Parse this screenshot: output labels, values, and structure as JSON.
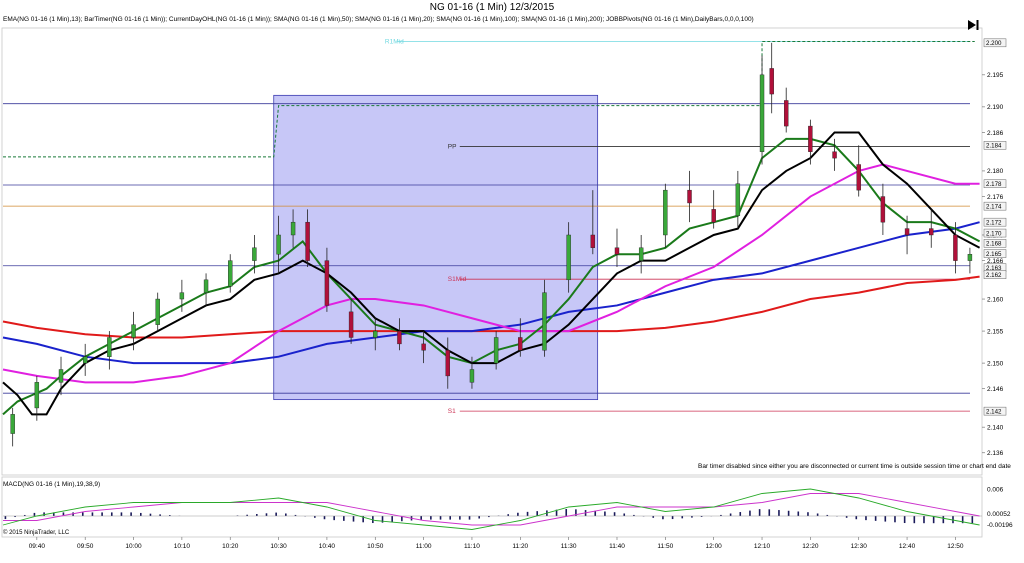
{
  "title": "NG 01-16 (1 Min)  12/3/2015",
  "indicators_line": "EMA(NG 01-16 (1 Min),13); BarTimer(NG 01-16 (1 Min)); CurrentDayOHL(NG 01-16 (1 Min)); SMA(NG 01-16 (1 Min),50); SMA(NG 01-16 (1 Min),20); SMA(NG 01-16 (1 Min),100); SMA(NG 01-16 (1 Min),200); JOBBPivots(NG 01-16 (1 Min),DailyBars,0,0,0,100)",
  "bar_timer_note": "Bar timer disabled since either you are disconnected or current time is outside session time or chart end date",
  "macd_label": "MACD(NG 01-16 (1 Min),19,38,9)",
  "copyright": "© 2015 NinjaTrader, LLC",
  "icons": {
    "play_to_end": "skip-to-end-icon"
  },
  "colors": {
    "up_bar": "#3aa83a",
    "down_bar": "#b0103a",
    "ema13": "#1a7a1a",
    "sma20": "#000000",
    "sma50": "#e020e0",
    "sma100": "#1a22cc",
    "sma200": "#e01a1a",
    "zone": "#b4b4f4",
    "macd": "#2aaa2a",
    "signal": "#cc33cc",
    "hist": "#1a1a5a"
  },
  "chart_data": {
    "type": "candlestick",
    "symbol": "NG 01-16",
    "interval": "1 Min",
    "date": "12/3/2015",
    "x_tick_labels": [
      "09:40",
      "09:50",
      "10:00",
      "10:10",
      "10:20",
      "10:30",
      "10:40",
      "10:50",
      "11:00",
      "11:10",
      "11:20",
      "11:30",
      "11:40",
      "11:50",
      "12:00",
      "12:10",
      "12:20",
      "12:30",
      "12:40",
      "12:50"
    ],
    "y_tick_labels": [
      "2.136",
      "2.140",
      "2.146",
      "2.150",
      "2.155",
      "2.160",
      "2.166",
      "2.170",
      "2.176",
      "2.180",
      "2.186",
      "2.190",
      "2.195"
    ],
    "ylim": [
      2.133,
      2.202
    ],
    "price_labels": [
      {
        "text": "2.200",
        "value": 2.2
      },
      {
        "text": "2.184",
        "value": 2.184
      },
      {
        "text": "2.178",
        "value": 2.178
      },
      {
        "text": "2.174",
        "value": 2.1745
      },
      {
        "text": "2.172",
        "value": 2.172
      },
      {
        "text": "2.170",
        "value": 2.1703
      },
      {
        "text": "2.168",
        "value": 2.1687
      },
      {
        "text": "2.165",
        "value": 2.1671
      },
      {
        "text": "2.163",
        "value": 2.1649
      },
      {
        "text": "2.162",
        "value": 2.1638
      },
      {
        "text": "2.142",
        "value": 2.1425
      }
    ],
    "pivot_levels": [
      {
        "label": "R1Mid",
        "value": 2.2002,
        "color": "#70d8e0"
      },
      {
        "label": "",
        "value": 2.1905,
        "color": "#3a3a9a"
      },
      {
        "label": "PP",
        "value": 2.1838,
        "color": "#333333"
      },
      {
        "label": "",
        "value": 2.1778,
        "color": "#3a3a9a"
      },
      {
        "label": "",
        "value": 2.1745,
        "color": "#d08a30"
      },
      {
        "label": "",
        "value": 2.1652,
        "color": "#3a3a9a"
      },
      {
        "label": "S1Mid",
        "value": 2.1631,
        "color": "#cc3355"
      },
      {
        "label": "",
        "value": 2.1453,
        "color": "#3a3a9a"
      },
      {
        "label": "S1",
        "value": 2.1425,
        "color": "#cc3355"
      }
    ],
    "day_high_step": [
      {
        "time": "09:33",
        "value": 2.1822
      },
      {
        "time": "10:29",
        "value": 2.1822
      },
      {
        "time": "10:30",
        "value": 2.1902
      },
      {
        "time": "12:10",
        "value": 2.1902
      },
      {
        "time": "12:10",
        "value": 2.2002
      },
      {
        "time": "12:54",
        "value": 2.2002
      }
    ],
    "zone": {
      "time_from": "10:29",
      "time_to": "11:36",
      "low": 2.1443,
      "high": 2.1918
    },
    "candles_sampled": {
      "times": [
        "09:35",
        "09:40",
        "09:45",
        "09:50",
        "09:55",
        "10:00",
        "10:05",
        "10:10",
        "10:15",
        "10:20",
        "10:25",
        "10:30",
        "10:33",
        "10:36",
        "10:40",
        "10:45",
        "10:50",
        "10:55",
        "11:00",
        "11:05",
        "11:10",
        "11:15",
        "11:20",
        "11:25",
        "11:30",
        "11:35",
        "11:40",
        "11:45",
        "11:50",
        "11:55",
        "12:00",
        "12:05",
        "12:10",
        "12:12",
        "12:15",
        "12:20",
        "12:25",
        "12:30",
        "12:35",
        "12:40",
        "12:45",
        "12:50",
        "12:53"
      ],
      "open": [
        2.139,
        2.143,
        2.147,
        2.15,
        2.151,
        2.154,
        2.156,
        2.16,
        2.161,
        2.162,
        2.166,
        2.167,
        2.17,
        2.172,
        2.166,
        2.158,
        2.154,
        2.155,
        2.153,
        2.152,
        2.147,
        2.15,
        2.154,
        2.152,
        2.163,
        2.17,
        2.168,
        2.166,
        2.17,
        2.177,
        2.174,
        2.173,
        2.183,
        2.196,
        2.191,
        2.187,
        2.183,
        2.181,
        2.176,
        2.171,
        2.171,
        2.17,
        2.166
      ],
      "high": [
        2.143,
        2.148,
        2.151,
        2.153,
        2.155,
        2.158,
        2.161,
        2.163,
        2.164,
        2.167,
        2.17,
        2.173,
        2.174,
        2.174,
        2.168,
        2.16,
        2.157,
        2.157,
        2.155,
        2.154,
        2.151,
        2.155,
        2.157,
        2.163,
        2.172,
        2.177,
        2.171,
        2.17,
        2.178,
        2.18,
        2.177,
        2.18,
        2.198,
        2.2,
        2.193,
        2.188,
        2.185,
        2.184,
        2.178,
        2.173,
        2.174,
        2.172,
        2.168
      ],
      "low": [
        2.137,
        2.141,
        2.145,
        2.148,
        2.149,
        2.152,
        2.155,
        2.158,
        2.159,
        2.161,
        2.164,
        2.164,
        2.168,
        2.165,
        2.158,
        2.153,
        2.152,
        2.152,
        2.15,
        2.146,
        2.146,
        2.149,
        2.151,
        2.151,
        2.161,
        2.167,
        2.165,
        2.164,
        2.168,
        2.172,
        2.171,
        2.171,
        2.181,
        2.189,
        2.186,
        2.181,
        2.18,
        2.176,
        2.17,
        2.167,
        2.168,
        2.164,
        2.164
      ],
      "close": [
        2.142,
        2.147,
        2.149,
        2.151,
        2.154,
        2.156,
        2.16,
        2.161,
        2.163,
        2.166,
        2.168,
        2.17,
        2.172,
        2.166,
        2.159,
        2.154,
        2.155,
        2.153,
        2.152,
        2.148,
        2.149,
        2.154,
        2.152,
        2.161,
        2.17,
        2.168,
        2.167,
        2.168,
        2.177,
        2.175,
        2.172,
        2.178,
        2.195,
        2.192,
        2.187,
        2.183,
        2.182,
        2.177,
        2.172,
        2.17,
        2.17,
        2.166,
        2.167
      ]
    },
    "series": [
      {
        "name": "SMA(NG 01-16 (1 Min),20)",
        "color": "#000000",
        "times": [
          "09:33",
          "09:36",
          "09:39",
          "09:42",
          "09:45",
          "09:50",
          "09:55",
          "10:00",
          "10:05",
          "10:10",
          "10:15",
          "10:20",
          "10:25",
          "10:30",
          "10:35",
          "10:40",
          "10:45",
          "10:50",
          "10:55",
          "11:00",
          "11:05",
          "11:10",
          "11:15",
          "11:20",
          "11:25",
          "11:30",
          "11:35",
          "11:40",
          "11:45",
          "11:50",
          "11:55",
          "12:00",
          "12:05",
          "12:10",
          "12:15",
          "12:20",
          "12:25",
          "12:30",
          "12:35",
          "12:40",
          "12:45",
          "12:50",
          "12:55"
        ],
        "values": [
          2.147,
          2.145,
          2.142,
          2.142,
          2.146,
          2.15,
          2.152,
          2.153,
          2.155,
          2.157,
          2.159,
          2.16,
          2.163,
          2.164,
          2.166,
          2.164,
          2.161,
          2.157,
          2.155,
          2.155,
          2.152,
          2.15,
          2.15,
          2.152,
          2.153,
          2.156,
          2.16,
          2.164,
          2.166,
          2.166,
          2.168,
          2.17,
          2.171,
          2.177,
          2.18,
          2.182,
          2.186,
          2.186,
          2.181,
          2.178,
          2.174,
          2.17,
          2.168
        ]
      },
      {
        "name": "EMA(NG 01-16 (1 Min),13)",
        "color": "#1a7a1a",
        "times": [
          "09:33",
          "09:36",
          "09:39",
          "09:42",
          "09:45",
          "09:50",
          "09:55",
          "10:00",
          "10:05",
          "10:10",
          "10:15",
          "10:20",
          "10:25",
          "10:30",
          "10:35",
          "10:40",
          "10:45",
          "10:50",
          "10:55",
          "11:00",
          "11:05",
          "11:10",
          "11:15",
          "11:20",
          "11:25",
          "11:30",
          "11:35",
          "11:40",
          "11:45",
          "11:50",
          "11:55",
          "12:00",
          "12:05",
          "12:10",
          "12:15",
          "12:20",
          "12:25",
          "12:30",
          "12:35",
          "12:40",
          "12:45",
          "12:50",
          "12:55"
        ],
        "values": [
          2.142,
          2.144,
          2.145,
          2.146,
          2.148,
          2.151,
          2.153,
          2.155,
          2.157,
          2.159,
          2.161,
          2.162,
          2.165,
          2.166,
          2.169,
          2.164,
          2.16,
          2.156,
          2.155,
          2.154,
          2.151,
          2.15,
          2.152,
          2.153,
          2.156,
          2.16,
          2.165,
          2.167,
          2.167,
          2.168,
          2.171,
          2.172,
          2.173,
          2.182,
          2.185,
          2.185,
          2.184,
          2.18,
          2.175,
          2.172,
          2.172,
          2.171,
          2.169
        ]
      },
      {
        "name": "SMA(NG 01-16 (1 Min),50)",
        "color": "#e020e0",
        "times": [
          "09:33",
          "09:40",
          "09:50",
          "10:00",
          "10:10",
          "10:20",
          "10:30",
          "10:40",
          "10:45",
          "10:50",
          "11:00",
          "11:10",
          "11:20",
          "11:30",
          "11:40",
          "11:50",
          "12:00",
          "12:10",
          "12:20",
          "12:30",
          "12:35",
          "12:40",
          "12:50",
          "12:55"
        ],
        "values": [
          2.149,
          2.148,
          2.147,
          2.147,
          2.148,
          2.15,
          2.155,
          2.159,
          2.16,
          2.16,
          2.159,
          2.157,
          2.155,
          2.155,
          2.158,
          2.162,
          2.165,
          2.17,
          2.176,
          2.18,
          2.181,
          2.18,
          2.178,
          2.178
        ]
      },
      {
        "name": "SMA(NG 01-16 (1 Min),100)",
        "color": "#1a22cc",
        "times": [
          "09:33",
          "09:40",
          "09:50",
          "10:00",
          "10:10",
          "10:20",
          "10:30",
          "10:40",
          "10:50",
          "11:00",
          "11:10",
          "11:20",
          "11:30",
          "11:40",
          "11:50",
          "12:00",
          "12:10",
          "12:20",
          "12:30",
          "12:40",
          "12:50",
          "12:55"
        ],
        "values": [
          2.154,
          2.153,
          2.151,
          2.15,
          2.15,
          2.15,
          2.151,
          2.153,
          2.154,
          2.155,
          2.155,
          2.156,
          2.158,
          2.159,
          2.161,
          2.163,
          2.164,
          2.166,
          2.168,
          2.17,
          2.171,
          2.172
        ]
      },
      {
        "name": "SMA(NG 01-16 (1 Min),200)",
        "color": "#e01a1a",
        "times": [
          "09:33",
          "09:40",
          "09:50",
          "10:00",
          "10:10",
          "10:20",
          "10:30",
          "10:40",
          "10:50",
          "11:00",
          "11:10",
          "11:20",
          "11:30",
          "11:40",
          "11:50",
          "12:00",
          "12:10",
          "12:20",
          "12:30",
          "12:40",
          "12:50",
          "12:55"
        ],
        "values": [
          2.1565,
          2.1555,
          2.1545,
          2.154,
          2.154,
          2.1545,
          2.155,
          2.155,
          2.155,
          2.155,
          2.155,
          2.155,
          2.155,
          2.155,
          2.1555,
          2.1565,
          2.158,
          2.16,
          2.161,
          2.1625,
          2.163,
          2.1635
        ]
      }
    ],
    "macd_panel": {
      "y_tick_labels": [
        "0.006",
        "0.00052",
        "-0.00196"
      ],
      "times": [
        "09:33",
        "09:40",
        "09:50",
        "10:00",
        "10:10",
        "10:20",
        "10:30",
        "10:40",
        "10:50",
        "11:00",
        "11:10",
        "11:20",
        "11:30",
        "11:40",
        "11:50",
        "12:00",
        "12:10",
        "12:20",
        "12:30",
        "12:40",
        "12:50",
        "12:55"
      ],
      "macd": [
        -0.002,
        0.0,
        0.002,
        0.003,
        0.003,
        0.003,
        0.004,
        0.002,
        -0.001,
        -0.002,
        -0.003,
        -0.001,
        0.002,
        0.003,
        0.001,
        0.002,
        0.005,
        0.006,
        0.004,
        0.001,
        -0.001,
        -0.002
      ],
      "signal": [
        -0.001,
        -0.001,
        0.001,
        0.002,
        0.003,
        0.003,
        0.003,
        0.003,
        0.001,
        -0.001,
        -0.002,
        -0.002,
        0.0,
        0.002,
        0.002,
        0.002,
        0.003,
        0.005,
        0.005,
        0.003,
        0.001,
        0.0
      ],
      "ylim": [
        -0.004,
        0.008
      ]
    }
  }
}
